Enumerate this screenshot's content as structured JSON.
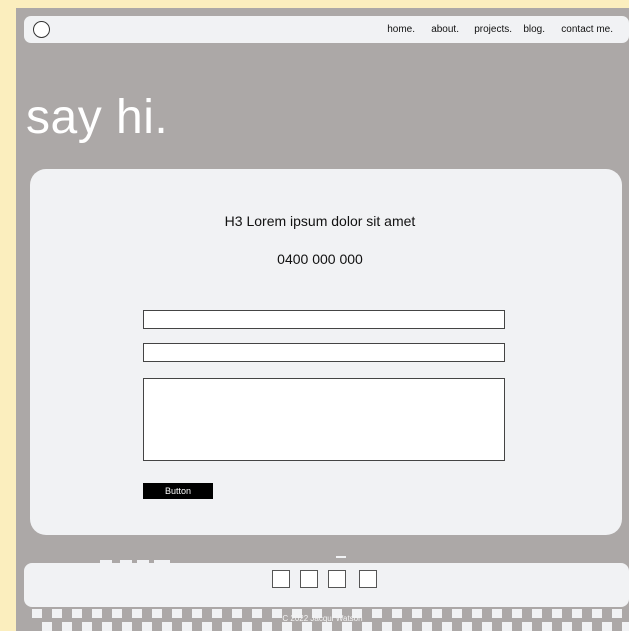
{
  "nav": {
    "links": [
      "home.",
      "about.",
      "projects.",
      "blog.",
      "contact me."
    ]
  },
  "hero": {
    "title": "say hi."
  },
  "card": {
    "heading": "H3 Lorem ipsum dolor sit amet",
    "phone": "0400 000 000",
    "button_label": "Button"
  },
  "footer": {
    "copyright": "C 2022 Jacqui Watson"
  },
  "colors": {
    "page_background": "#fbeebe",
    "frame_background": "#aca8a7",
    "panel": "#f1f2f4",
    "button": "#000000",
    "hero_text": "#ffffff"
  },
  "icons": [
    "logo-circle-icon",
    "social-square-icon"
  ]
}
